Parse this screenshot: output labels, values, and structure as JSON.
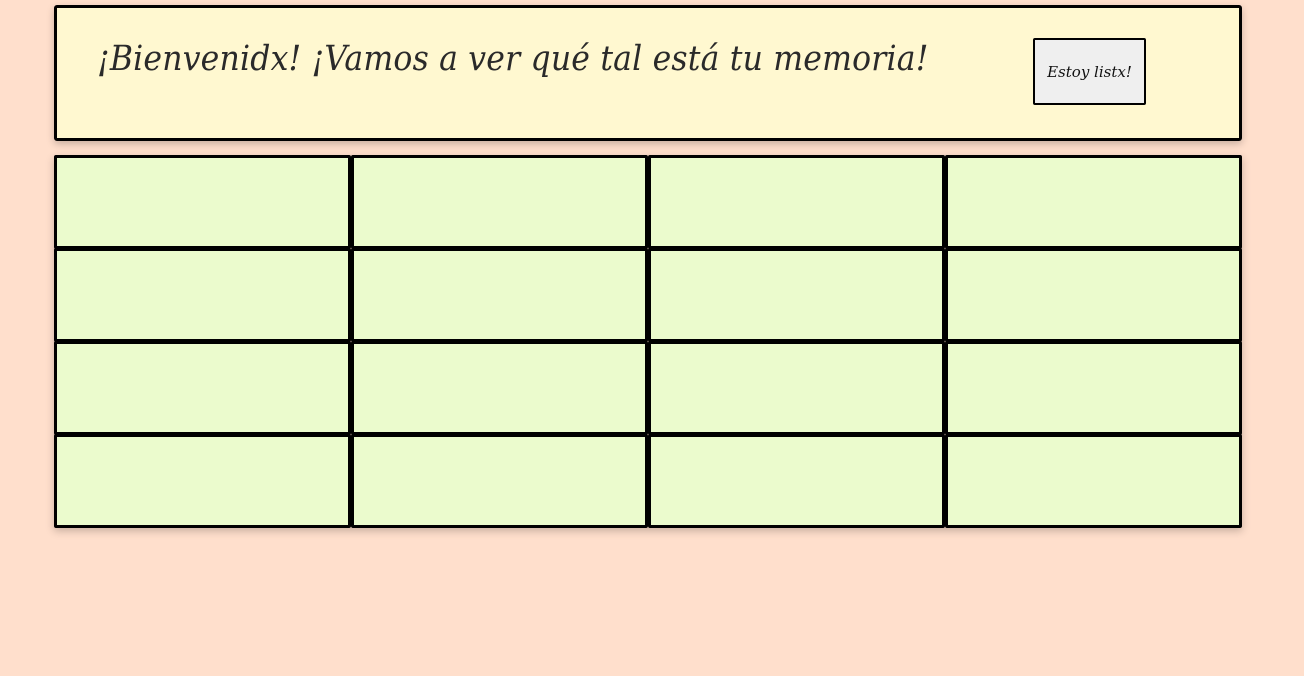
{
  "header": {
    "title": "¡Bienvenidx! ¡Vamos a ver qué tal está tu memoria!",
    "ready_button_label": "Estoy listx!"
  },
  "board": {
    "rows": 4,
    "columns": 4,
    "card_face_down_color": "#ebfbcd",
    "cards": [
      {
        "id": 1
      },
      {
        "id": 2
      },
      {
        "id": 3
      },
      {
        "id": 4
      },
      {
        "id": 5
      },
      {
        "id": 6
      },
      {
        "id": 7
      },
      {
        "id": 8
      },
      {
        "id": 9
      },
      {
        "id": 10
      },
      {
        "id": 11
      },
      {
        "id": 12
      },
      {
        "id": 13
      },
      {
        "id": 14
      },
      {
        "id": 15
      },
      {
        "id": 16
      }
    ]
  },
  "colors": {
    "background": "#ffdfcc",
    "header_background": "#fff8d0",
    "button_background": "#efefef"
  }
}
